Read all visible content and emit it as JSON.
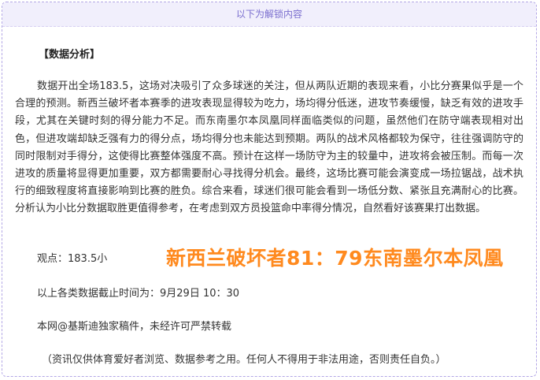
{
  "banner": {
    "text": "以下为解锁内容"
  },
  "article": {
    "heading": "【数据分析】",
    "body": "数据开出全场183.5，这场对决吸引了众多球迷的关注，但从两队近期的表现来看，小比分赛果似乎是一个合理的预测。新西兰破坏者本赛季的进攻表现显得较为吃力，场均得分低迷，进攻节奏缓慢，缺乏有效的进攻手段，尤其在关键时刻的得分能力不足。而东南墨尔本凤凰同样面临类似的问题，虽然他们在防守端表现相对出色，但进攻端却缺乏强有力的得分点，场均得分也未能达到预期。两队的战术风格都较为保守，往往强调防守的同时限制对手得分，这使得比赛整体强度不高。预计在这样一场防守为主的较量中，进攻将会被压制。而每一次进攻的质量将显得更加重要，双方都需要耐心寻找得分机会。最终，这场比赛可能会演变成一场拉锯战，战术执行的细致程度将直接影响到比赛的胜负。综合来看，球迷们很可能会看到一场低分数、紧张且充满耐心的比赛。分析认为小比分数据取胜更值得参考，在考虑到双方员投篮命中率得分情况，自然看好该赛果打出数据。",
    "viewpoint": "观点：183.5小",
    "score_overlay": "新西兰破坏者81：79东南墨尔本凤凰",
    "data_time": "以上各类数据截止时间为：9月29日 10：30",
    "source": "本网@基斯迪独家稿件，未经许可严禁转载",
    "disclaimer": "（资讯仅供体育爱好者浏览、数据参考之用。任何人不得用于非法用途，否则责任自负。）"
  },
  "colors": {
    "banner_bg": "#f1effc",
    "banner_text": "#7b6fcf",
    "overlay": "#ff8a1f",
    "border": "#b3a7e6"
  }
}
